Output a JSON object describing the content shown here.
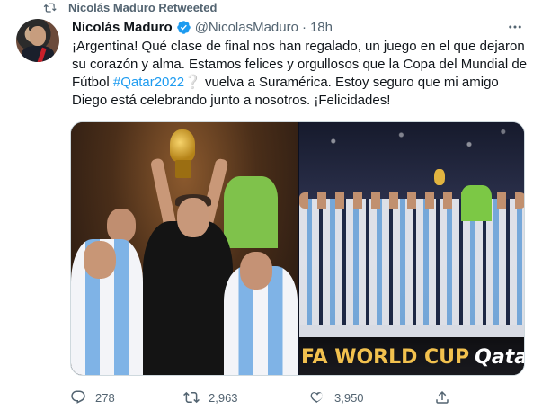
{
  "retweet_banner": {
    "text": "Nicolás Maduro Retweeted",
    "icon": "retweet-icon"
  },
  "tweet": {
    "author_name": "Nicolás Maduro",
    "verified": true,
    "handle": "@NicolasMaduro",
    "separator": "·",
    "time": "18h",
    "more_icon": "more-icon",
    "text_lines": [
      "¡Argentina! Qué clase de final nos han regalado, un juego en el que dejaron",
      "su corazón y alma. Estamos felices y orgullosos que la Copa del Mundial de",
      {
        "before": "Fútbol ",
        "hashtag": "#Qatar2022",
        "emoji": "❔",
        "after": " vuelva a Suramérica. Estoy seguro que mi amigo"
      },
      "Diego está celebrando junto a nosotros. ¡Felicidades!"
    ],
    "media": {
      "left_photo": "argentina-players-celebrating-with-trophy",
      "right_photo": "argentina-team-on-stage",
      "banner_text_main": "FA WORLD CUP",
      "banner_text_qatar": "Qatar"
    },
    "actions": {
      "replies": "278",
      "retweets": "2,963",
      "likes": "3,950"
    },
    "colors": {
      "accent": "#1d9bf0",
      "secondary_text": "#536471",
      "primary_text": "#0f1419"
    }
  }
}
